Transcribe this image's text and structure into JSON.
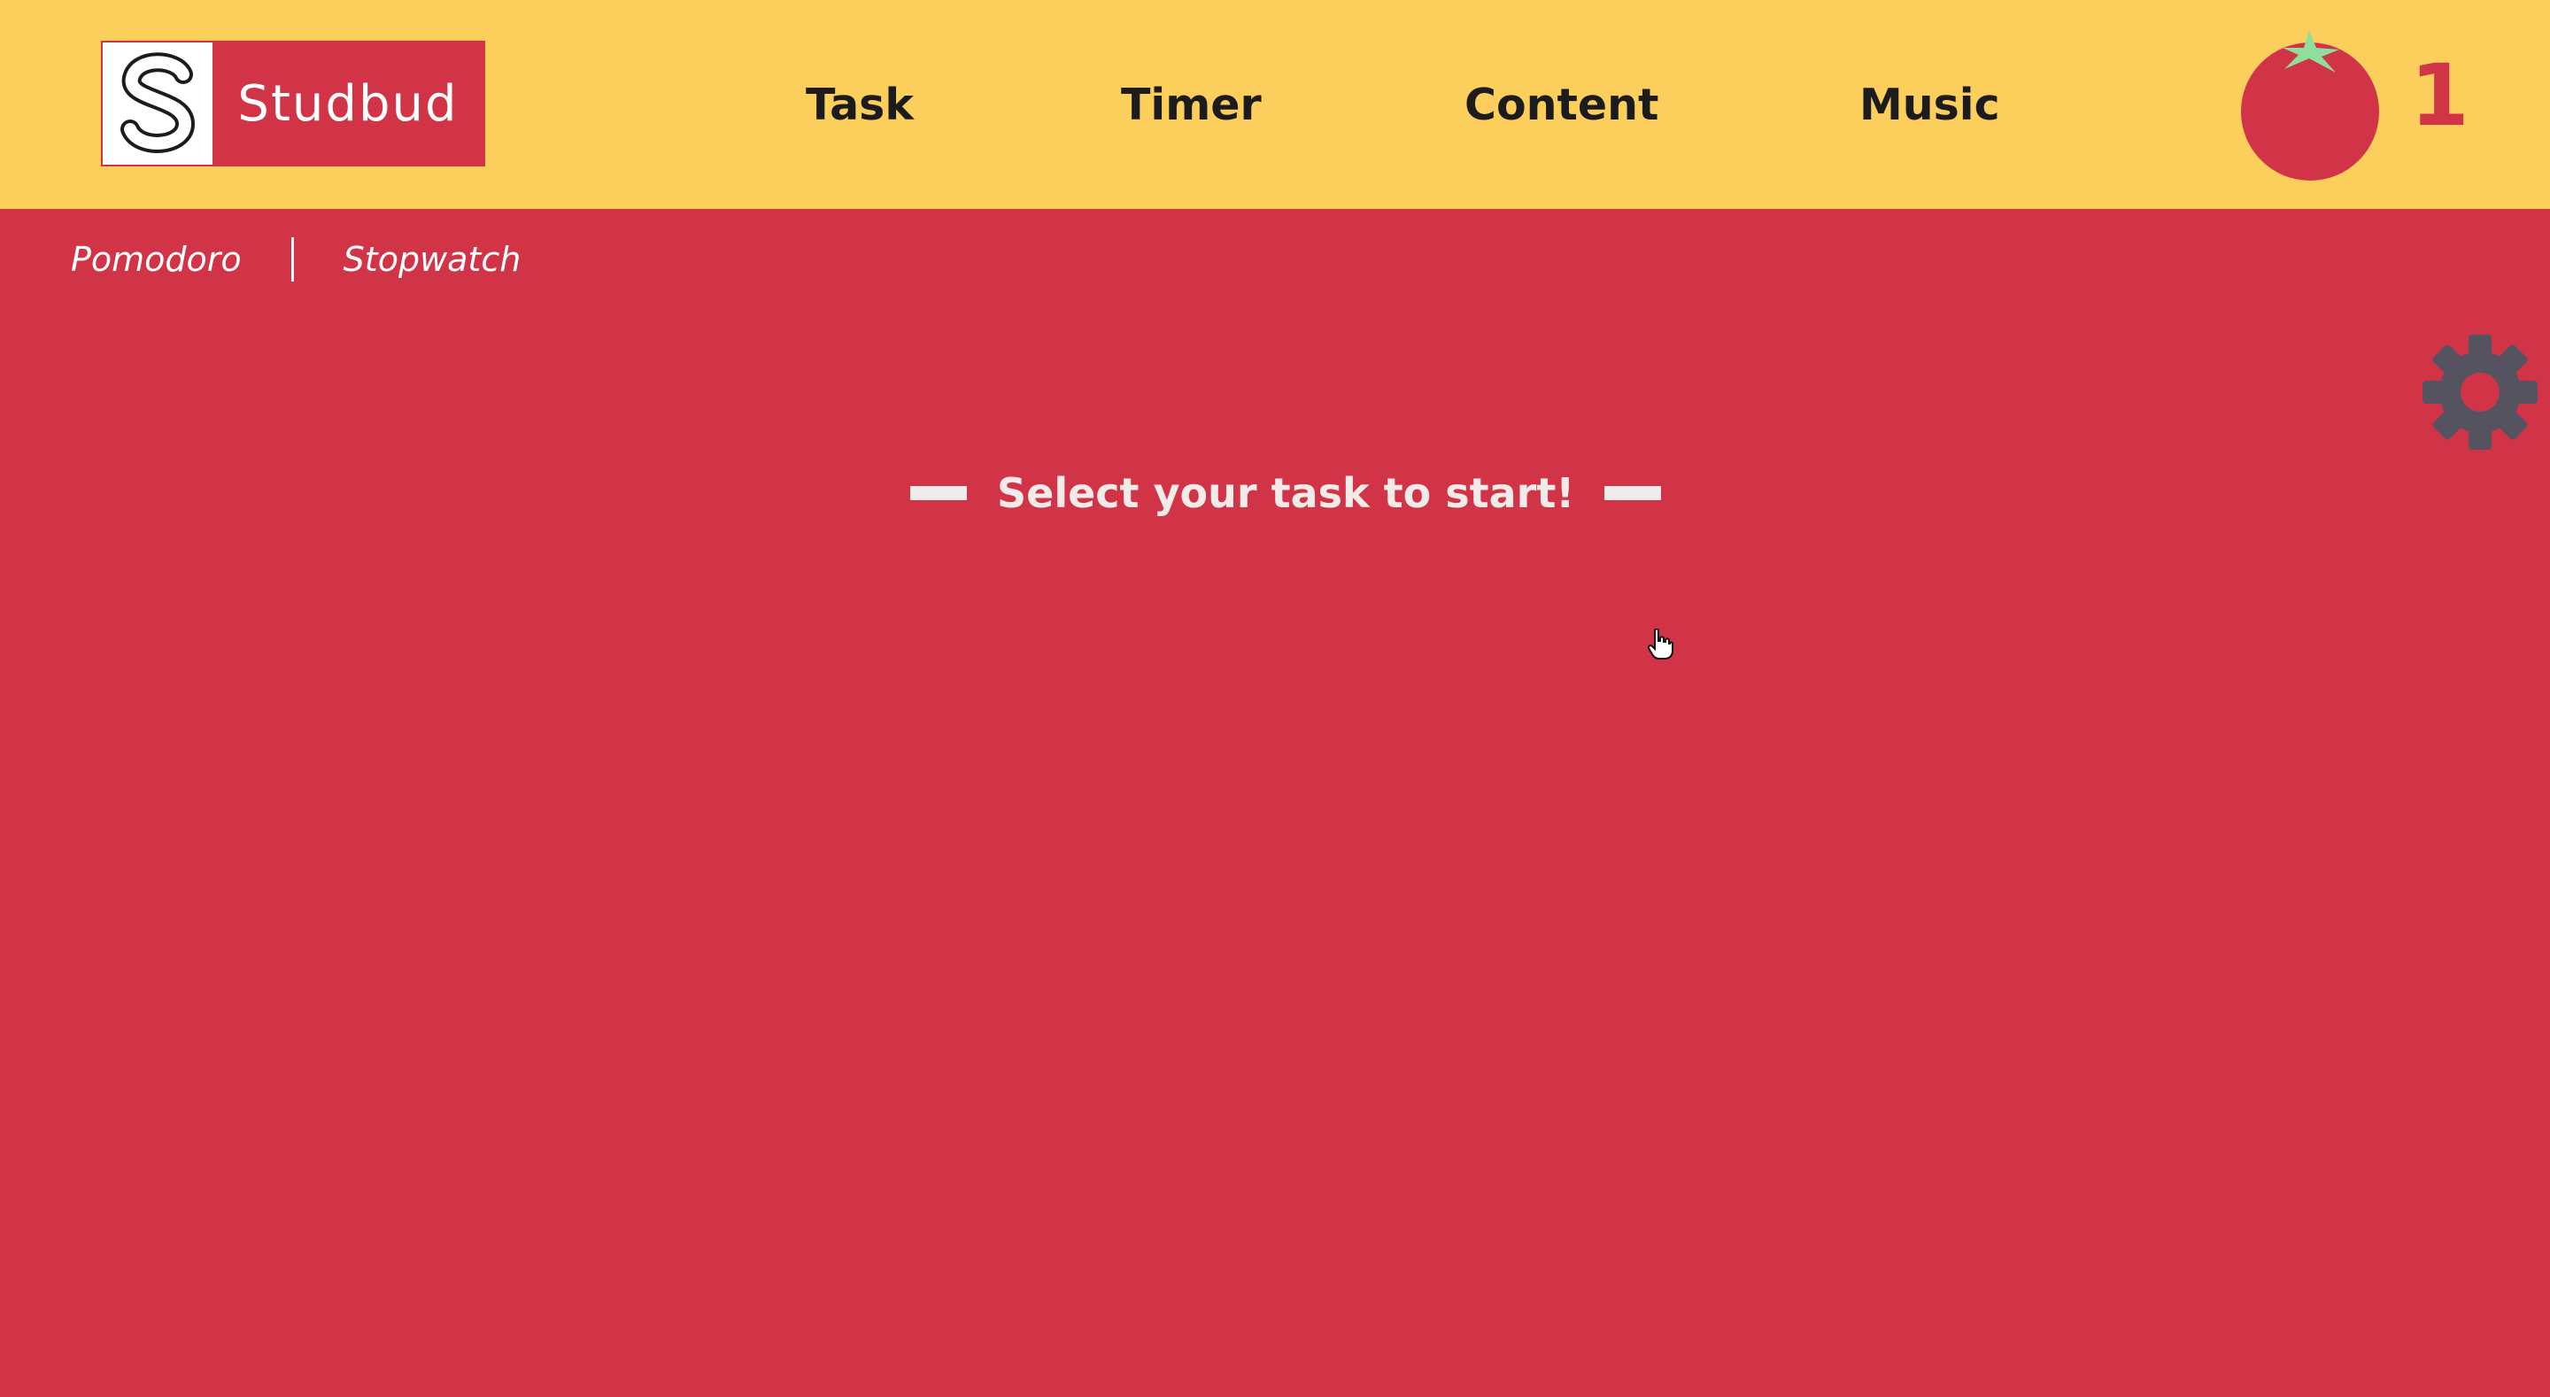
{
  "header": {
    "logo_text": "Studbud",
    "nav": [
      "Task",
      "Timer",
      "Content",
      "Music"
    ],
    "pomodoro_count": "1"
  },
  "subnav": {
    "items": [
      "Pomodoro",
      "Stopwatch"
    ]
  },
  "main": {
    "prompt": "Select your task to start!"
  },
  "icons": {
    "logo": "s-logo-icon",
    "tomato": "tomato-icon",
    "settings": "gear-icon",
    "cursor": "hand-cursor-icon"
  },
  "colors": {
    "header_bg": "#fcce5b",
    "page_bg": "#d23447",
    "accent_red": "#d23447",
    "nav_text": "#1c1c1c",
    "gear": "#55535f",
    "tomato_leaf": "#8ddf9b"
  }
}
